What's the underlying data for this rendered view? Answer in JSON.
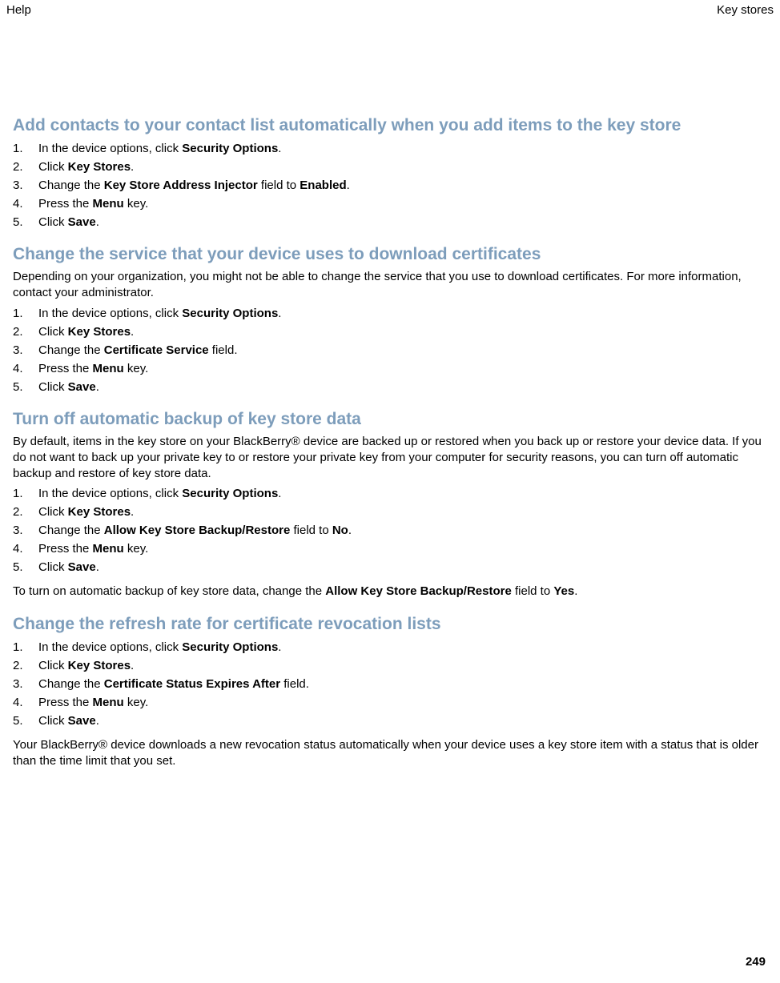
{
  "header": {
    "left": "Help",
    "right": "Key stores"
  },
  "sections": [
    {
      "heading": "Add contacts to your contact list automatically when you add items to the key store",
      "intro": null,
      "steps": [
        [
          {
            "t": "In the device options, click "
          },
          {
            "t": "Security Options",
            "b": true
          },
          {
            "t": "."
          }
        ],
        [
          {
            "t": "Click "
          },
          {
            "t": "Key Stores",
            "b": true
          },
          {
            "t": "."
          }
        ],
        [
          {
            "t": "Change the "
          },
          {
            "t": "Key Store Address Injector",
            "b": true
          },
          {
            "t": " field to "
          },
          {
            "t": "Enabled",
            "b": true
          },
          {
            "t": "."
          }
        ],
        [
          {
            "t": "Press the "
          },
          {
            "t": "Menu",
            "b": true
          },
          {
            "t": " key."
          }
        ],
        [
          {
            "t": "Click "
          },
          {
            "t": "Save",
            "b": true
          },
          {
            "t": "."
          }
        ]
      ],
      "followup": null
    },
    {
      "heading": "Change the service that your device uses to download certificates",
      "intro": "Depending on your organization, you might not be able to change the service that you use to download certificates. For more information, contact your administrator.",
      "steps": [
        [
          {
            "t": "In the device options, click "
          },
          {
            "t": "Security Options",
            "b": true
          },
          {
            "t": "."
          }
        ],
        [
          {
            "t": "Click "
          },
          {
            "t": "Key Stores",
            "b": true
          },
          {
            "t": "."
          }
        ],
        [
          {
            "t": "Change the "
          },
          {
            "t": "Certificate Service",
            "b": true
          },
          {
            "t": " field."
          }
        ],
        [
          {
            "t": "Press the "
          },
          {
            "t": "Menu",
            "b": true
          },
          {
            "t": " key."
          }
        ],
        [
          {
            "t": "Click "
          },
          {
            "t": "Save",
            "b": true
          },
          {
            "t": "."
          }
        ]
      ],
      "followup": null
    },
    {
      "heading": "Turn off automatic backup of key store data",
      "intro": "By default, items in the key store on your BlackBerry® device are backed up or restored when you back up or restore your device data. If you do not want to back up your private key to or restore your private key from your computer for security reasons, you can turn off automatic backup and restore of key store data.",
      "steps": [
        [
          {
            "t": "In the device options, click "
          },
          {
            "t": "Security Options",
            "b": true
          },
          {
            "t": "."
          }
        ],
        [
          {
            "t": "Click "
          },
          {
            "t": "Key Stores",
            "b": true
          },
          {
            "t": "."
          }
        ],
        [
          {
            "t": "Change the "
          },
          {
            "t": "Allow Key Store Backup/Restore",
            "b": true
          },
          {
            "t": " field to "
          },
          {
            "t": "No",
            "b": true
          },
          {
            "t": "."
          }
        ],
        [
          {
            "t": "Press the "
          },
          {
            "t": "Menu",
            "b": true
          },
          {
            "t": " key."
          }
        ],
        [
          {
            "t": "Click "
          },
          {
            "t": "Save",
            "b": true
          },
          {
            "t": "."
          }
        ]
      ],
      "followup": [
        {
          "t": "To turn on automatic backup of key store data, change the "
        },
        {
          "t": "Allow Key Store Backup/Restore",
          "b": true
        },
        {
          "t": " field to "
        },
        {
          "t": "Yes",
          "b": true
        },
        {
          "t": "."
        }
      ]
    },
    {
      "heading": "Change the refresh rate for certificate revocation lists",
      "intro": null,
      "steps": [
        [
          {
            "t": "In the device options, click "
          },
          {
            "t": "Security Options",
            "b": true
          },
          {
            "t": "."
          }
        ],
        [
          {
            "t": "Click "
          },
          {
            "t": "Key Stores",
            "b": true
          },
          {
            "t": "."
          }
        ],
        [
          {
            "t": "Change the "
          },
          {
            "t": "Certificate Status Expires After",
            "b": true
          },
          {
            "t": " field."
          }
        ],
        [
          {
            "t": "Press the "
          },
          {
            "t": "Menu",
            "b": true
          },
          {
            "t": " key."
          }
        ],
        [
          {
            "t": "Click "
          },
          {
            "t": "Save",
            "b": true
          },
          {
            "t": "."
          }
        ]
      ],
      "followup": [
        {
          "t": "Your BlackBerry® device downloads a new revocation status automatically when your device uses a key store item with a status that is older than the time limit that you set."
        }
      ]
    }
  ],
  "page_number": "249"
}
